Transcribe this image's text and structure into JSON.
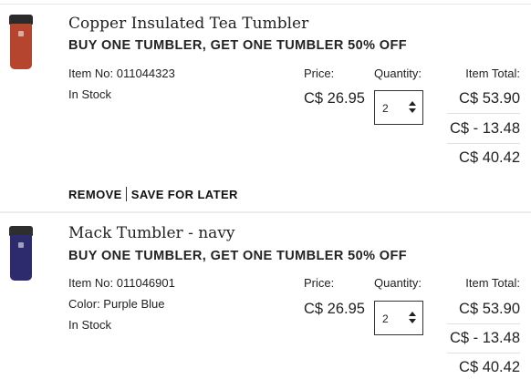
{
  "cart": {
    "items": [
      {
        "name": "Copper Insulated Tea Tumbler",
        "promo": "BUY ONE TUMBLER, GET ONE TUMBLER 50% OFF",
        "item_no": "Item No: 011044323",
        "color": "",
        "stock": "In Stock",
        "price_label": "Price:",
        "price": "C$ 26.95",
        "quantity_label": "Quantity:",
        "quantity": "2",
        "total_label": "Item Total:",
        "subtotal": "C$ 53.90",
        "discount": "C$ - 13.48",
        "total": "C$ 40.42",
        "remove_label": "REMOVE",
        "save_label": "SAVE FOR LATER",
        "thumb_colors": {
          "lid": "#2b2b2b",
          "body": "#b5452f"
        }
      },
      {
        "name": "Mack Tumbler - navy",
        "promo": "BUY ONE TUMBLER, GET ONE TUMBLER 50% OFF",
        "item_no": "Item No: 011046901",
        "color": "Color: Purple Blue",
        "stock": "In Stock",
        "price_label": "Price:",
        "price": "C$ 26.95",
        "quantity_label": "Quantity:",
        "quantity": "2",
        "total_label": "Item Total:",
        "subtotal": "C$ 53.90",
        "discount": "C$ - 13.48",
        "total": "C$ 40.42",
        "thumb_colors": {
          "lid": "#2e2e2e",
          "body": "#2e2a6e"
        }
      }
    ]
  },
  "icons": {
    "quantity_select": "select-arrows-icon",
    "thumbnail": "tumbler-icon"
  }
}
